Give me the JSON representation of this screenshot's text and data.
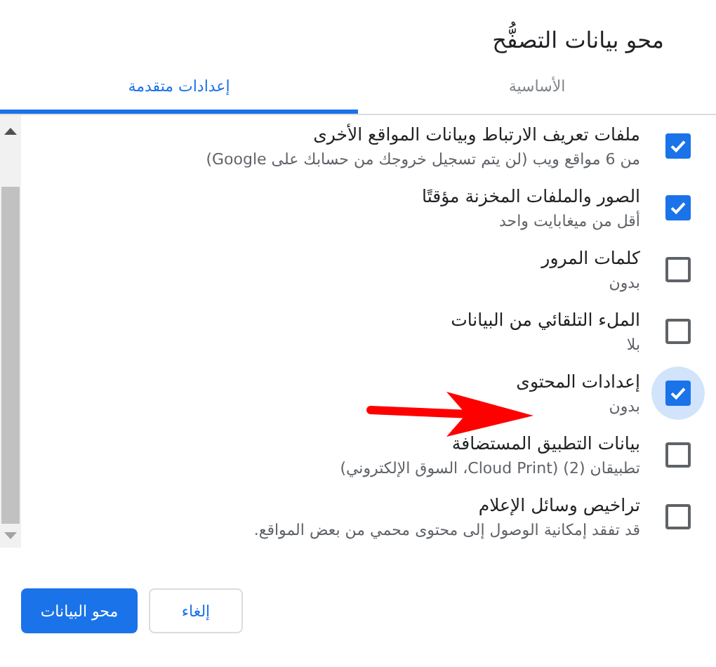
{
  "dialog": {
    "title": "محو بيانات التصفُّح"
  },
  "tabs": [
    {
      "label": "الأساسية",
      "selected": false
    },
    {
      "label": "إعدادات متقدمة",
      "selected": true
    }
  ],
  "items": [
    {
      "title": "ملفات تعريف الارتباط وبيانات المواقع الأخرى",
      "subtitle": "من 6 مواقع ويب (لن يتم تسجيل خروجك من حسابك على Google)",
      "checked": true,
      "focused": false
    },
    {
      "title": "الصور والملفات المخزنة مؤقتًا",
      "subtitle": "أقل من ميغابايت واحد",
      "checked": true,
      "focused": false
    },
    {
      "title": "كلمات المرور",
      "subtitle": "بدون",
      "checked": false,
      "focused": false
    },
    {
      "title": "الملء التلقائي من البيانات",
      "subtitle": "بلا",
      "checked": false,
      "focused": false
    },
    {
      "title": "إعدادات المحتوى",
      "subtitle": "بدون",
      "checked": true,
      "focused": true
    },
    {
      "title": "بيانات التطبيق المستضافة",
      "subtitle": "تطبيقان (2) (Cloud Print، السوق الإلكتروني)",
      "checked": false,
      "focused": false
    },
    {
      "title": "تراخيص وسائل الإعلام",
      "subtitle": "قد تفقد إمكانية الوصول إلى محتوى محمي من بعض المواقع.",
      "checked": false,
      "focused": false
    }
  ],
  "buttons": {
    "primary": "محو البيانات",
    "cancel": "إلغاء"
  }
}
